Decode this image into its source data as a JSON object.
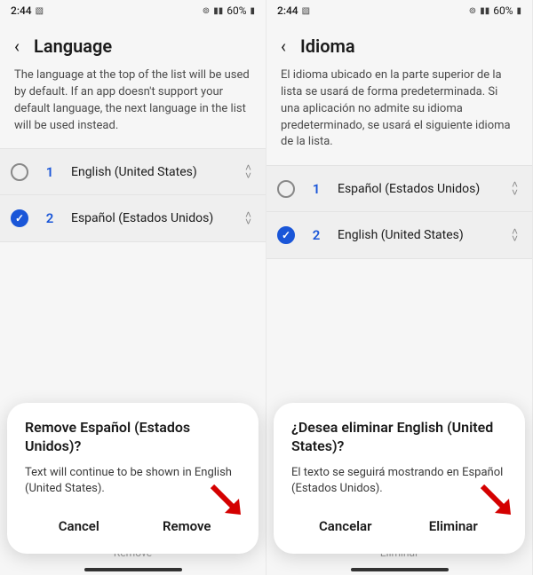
{
  "left": {
    "status": {
      "time": "2:44",
      "battery": "60%"
    },
    "title": "Language",
    "description": "The language at the top of the list will be used by default. If an app doesn't support your default language, the next language in the list will be used instead.",
    "items": [
      {
        "num": "1",
        "label": "English (United States)",
        "checked": false
      },
      {
        "num": "2",
        "label": "Español (Estados Unidos)",
        "checked": true
      }
    ],
    "hidden_action": "Remove",
    "dialog": {
      "title": "Remove Español (Estados Unidos)?",
      "body": "Text will continue to be shown in English (United States).",
      "cancel": "Cancel",
      "confirm": "Remove"
    }
  },
  "right": {
    "status": {
      "time": "2:44",
      "battery": "60%"
    },
    "title": "Idioma",
    "description": "El idioma ubicado en la parte superior de la lista se usará de forma predeterminada. Si una aplicación no admite su idioma predeterminado, se usará el siguiente idioma de la lista.",
    "items": [
      {
        "num": "1",
        "label": "Español (Estados Unidos)",
        "checked": false
      },
      {
        "num": "2",
        "label": "English (United States)",
        "checked": true
      }
    ],
    "hidden_action": "Eliminar",
    "dialog": {
      "title": "¿Desea eliminar English (United States)?",
      "body": "El texto se seguirá mostrando en Español (Estados Unidos).",
      "cancel": "Cancelar",
      "confirm": "Eliminar"
    }
  }
}
